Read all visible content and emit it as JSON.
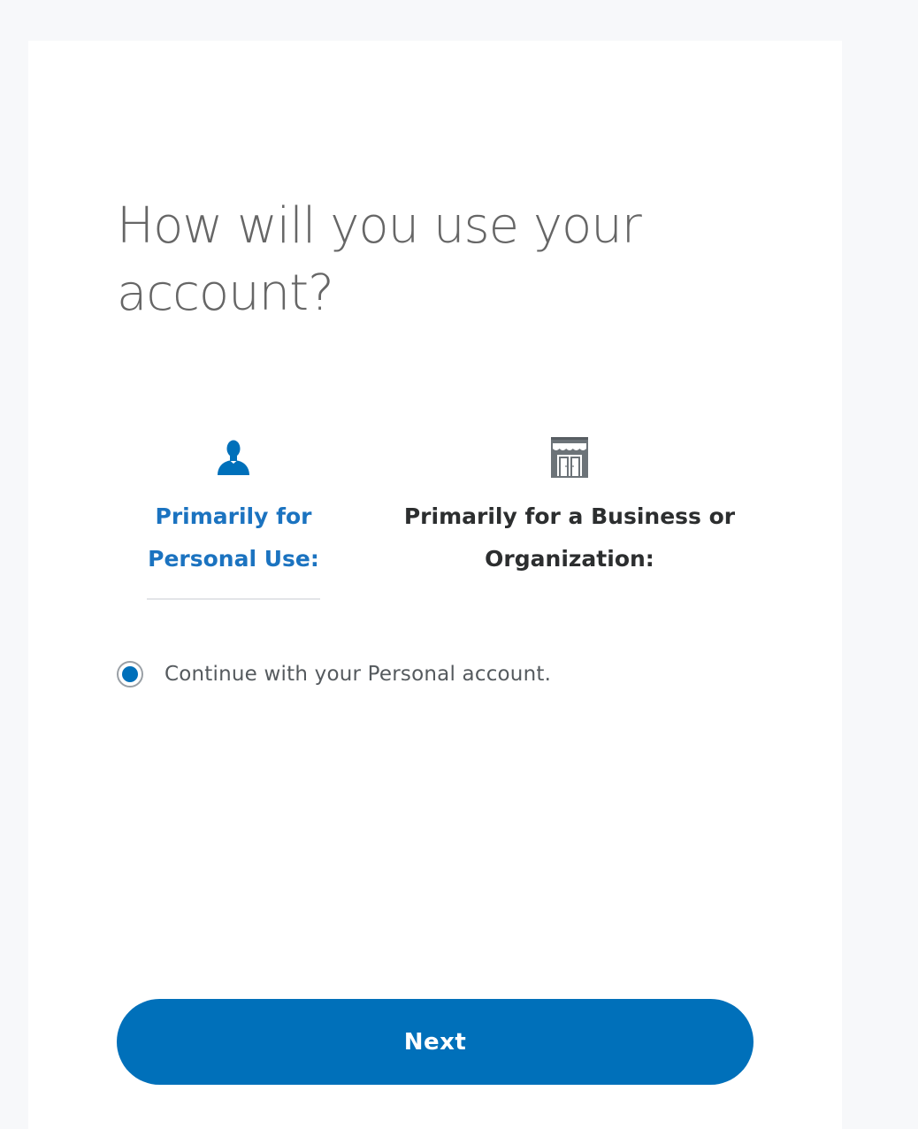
{
  "page": {
    "heading": "How will you use your account?"
  },
  "tabs": [
    {
      "label": "Primarily for Personal Use:",
      "icon": "person-icon",
      "selected": true
    },
    {
      "label": "Primarily for a Business or Organization:",
      "icon": "storefront-icon",
      "selected": false
    }
  ],
  "option": {
    "label": "Continue with your Personal account.",
    "checked": true
  },
  "actions": {
    "next_label": "Next"
  },
  "colors": {
    "accent": "#0070ba",
    "selected_tab_text": "#1b73c0",
    "heading_text": "#666666",
    "icon_gray": "#6c7378",
    "background": "#f7f8fa"
  }
}
